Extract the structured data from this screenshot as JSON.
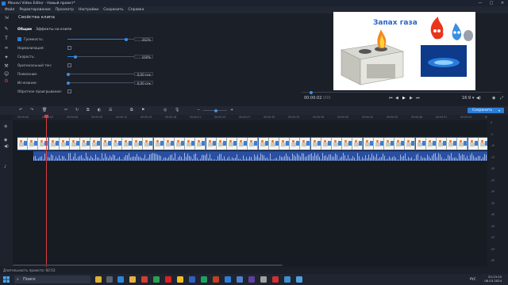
{
  "window": {
    "title": "Movavi Video Editor - Новый проект*",
    "minimize": "—",
    "maximize": "□",
    "close": "✕"
  },
  "menu": [
    "Файл",
    "Редактирование",
    "Просмотр",
    "Настройки",
    "Сохранить",
    "Справка"
  ],
  "tools": [
    "import-icon",
    "pen-icon",
    "text-icon",
    "transition-icon",
    "filter-icon",
    "magic-icon",
    "sticker-icon",
    "pointer-icon"
  ],
  "panel": {
    "title": "Свойства клипа",
    "tabs": [
      "Общие",
      "Эффекты на клипе"
    ],
    "rows": {
      "volume_label": "Громкость:",
      "volume_value": "262%",
      "volume_level": 0.88,
      "normalize_label": "Нормализация:",
      "speed_label": "Скорость:",
      "speed_value": "100%",
      "speed_level": 0.12,
      "orig_tone_label": "Оригинальный тон:",
      "fadein_label": "Появление:",
      "fadein_value": "0,00 сек",
      "fadeout_label": "Исчезание:",
      "fadeout_value": "0,00 сек",
      "reverse_label": "Обратное проигрывание:"
    }
  },
  "preview": {
    "title": "Запах газа"
  },
  "player": {
    "timecode": "00:00:02",
    "timecode_ms": ".000",
    "aspect": "16:9 ▾",
    "progress": 0.04
  },
  "timeline": {
    "save_label": "Сохранить",
    "ruler": [
      "00:00:00",
      "00:00:03",
      "00:00:06",
      "00:00:09",
      "00:00:12",
      "00:00:15",
      "00:00:18",
      "00:00:21",
      "00:00:24",
      "00:00:27",
      "00:00:30",
      "00:00:33",
      "00:00:36",
      "00:00:39",
      "00:00:42",
      "00:00:45",
      "00:00:48",
      "00:00:51",
      "00:00:54",
      "00:00:57"
    ],
    "meter": [
      "0",
      "-5",
      "-10",
      "-15",
      "-20",
      "-25",
      "-30",
      "-35",
      "-40",
      "-45",
      "-50",
      "-55",
      "-60"
    ]
  },
  "status": {
    "duration": "Длительность проекта: 00:53"
  },
  "taskbar": {
    "search_placeholder": "Поиск",
    "time": "20:13:10",
    "date": "08.03.2024",
    "lang": "РУС"
  },
  "colors": {
    "accent": "#2b7fd8",
    "playhead": "#d84040"
  }
}
